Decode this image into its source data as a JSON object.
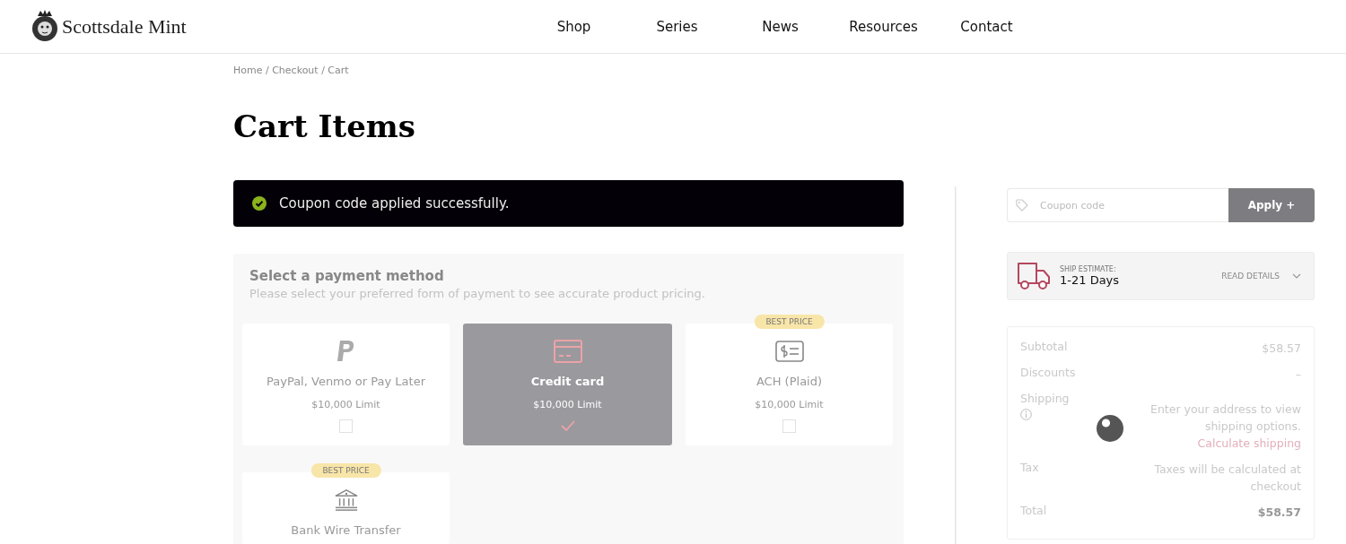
{
  "header": {
    "logo_text": "Scottsdale Mint",
    "nav": [
      {
        "label": "Shop"
      },
      {
        "label": "Series"
      },
      {
        "label": "News"
      },
      {
        "label": "Resources"
      },
      {
        "label": "Contact"
      }
    ]
  },
  "breadcrumb": "Home / Checkout / Cart",
  "page_title": "Cart Items",
  "notice": {
    "kind": "success",
    "text": "Coupon code applied successfully."
  },
  "payment": {
    "title": "Select a payment method",
    "subtitle": "Please select your preferred form of payment to see accurate product pricing.",
    "methods": [
      {
        "kind": "paypal",
        "label": "PayPal, Venmo or Pay Later",
        "limit": "$10,000 Limit",
        "selected": false
      },
      {
        "kind": "card",
        "label": "Credit card",
        "limit": "$10,000 Limit",
        "selected": true
      },
      {
        "kind": "ach",
        "label": "ACH (Plaid)",
        "limit": "$10,000 Limit",
        "selected": false,
        "badge": "BEST PRICE"
      },
      {
        "kind": "bank",
        "label": "Bank Wire Transfer",
        "selected": false,
        "badge": "BEST PRICE"
      }
    ]
  },
  "coupon": {
    "placeholder": "Coupon code",
    "button": "Apply +"
  },
  "ship_estimate": {
    "label": "SHIP ESTIMATE:",
    "value": "1-21 Days",
    "details": "READ DETAILS",
    "expanded": false
  },
  "summary": [
    {
      "kind": "plain",
      "label": "Subtotal",
      "value": "$58.57"
    },
    {
      "kind": "plain",
      "label": "Discounts",
      "value": "–"
    },
    {
      "kind": "shipping",
      "label": "Shipping",
      "value": "Enter your address to view shipping options.",
      "link": "Calculate shipping"
    },
    {
      "kind": "plain",
      "label": "Tax",
      "value": "Taxes will be calculated at checkout"
    },
    {
      "kind": "total",
      "label": "Total",
      "value": "$58.57"
    }
  ]
}
